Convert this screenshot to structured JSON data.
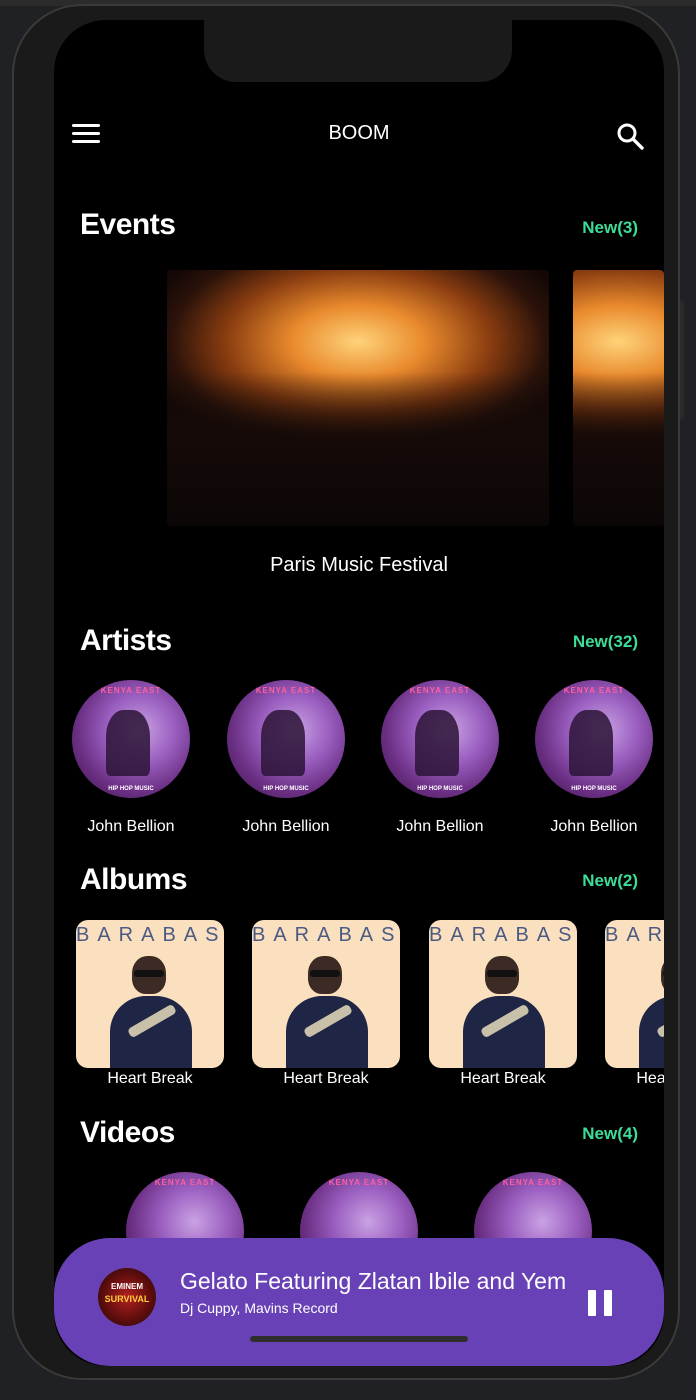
{
  "app": {
    "title": "BOOM"
  },
  "colors": {
    "accent_new": "#3ddc97",
    "player_bg": "#6741b5",
    "background": "#000000"
  },
  "icons": {
    "menu": "hamburger-menu-icon",
    "search": "search-icon",
    "pause": "pause-icon"
  },
  "events": {
    "title": "Events",
    "new_label": "New(3)",
    "items": [
      {
        "caption": "Paris Music Festival"
      }
    ]
  },
  "artists": {
    "title": "Artists",
    "new_label": "New(32)",
    "cover_brand": "KENYA EAST",
    "cover_footer": "HIP HOP MUSIC",
    "items": [
      {
        "name": "John Bellion"
      },
      {
        "name": "John Bellion"
      },
      {
        "name": "John Bellion"
      },
      {
        "name": "John Bellion"
      }
    ]
  },
  "albums": {
    "title": "Albums",
    "new_label": "New(2)",
    "cover_title": "BARABAS",
    "items": [
      {
        "name": "Heart Break"
      },
      {
        "name": "Heart Break"
      },
      {
        "name": "Heart Break"
      },
      {
        "name": "Heart Break"
      }
    ]
  },
  "videos": {
    "title": "Videos",
    "new_label": "New(4)",
    "cover_brand": "KENYA EAST"
  },
  "now_playing": {
    "song": "Gelato Featuring Zlatan Ibile and Yem",
    "artist": "Dj Cuppy, Mavins Record",
    "thumb_line1": "EMINEM",
    "thumb_line2": "SURVIVAL"
  }
}
